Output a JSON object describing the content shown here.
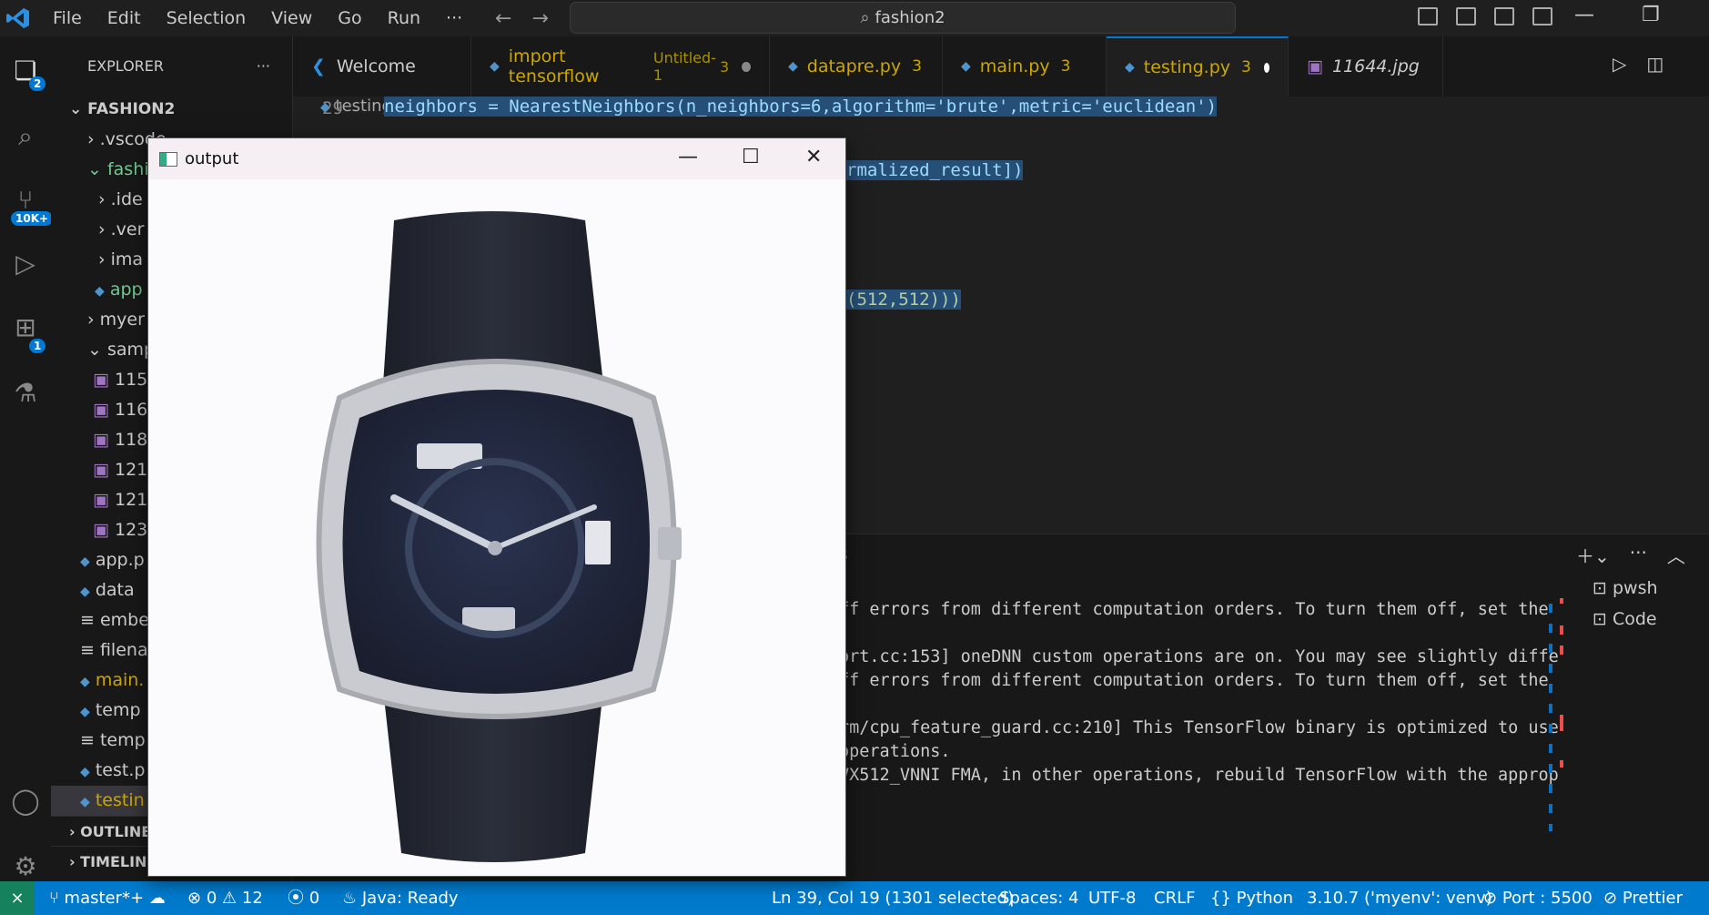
{
  "titlebar": {
    "menu": [
      "File",
      "Edit",
      "Selection",
      "View",
      "Go",
      "Run",
      "···"
    ],
    "search": "fashion2"
  },
  "activity": {
    "explorer_badge": "2",
    "scm_badge": "10K+",
    "ext_badge": "1"
  },
  "sidebar": {
    "title": "EXPLORER",
    "more": "···",
    "root": "FASHION2",
    "items": [
      ".vscode",
      "fashio",
      ".ide",
      ".ver",
      "ima",
      "app",
      "myer",
      "samp",
      "115",
      "116",
      "118",
      "121",
      "121",
      "123",
      "app.p",
      "data",
      "embe",
      "filena",
      "main.",
      "temp",
      "temp",
      "test.p",
      "testin"
    ],
    "outline": "OUTLINE",
    "timeline": "TIMELINE"
  },
  "tabs": [
    {
      "label": "Welcome"
    },
    {
      "label": "import tensorflow",
      "suffix": "Untitled-1",
      "count": "3"
    },
    {
      "label": "datapre.py",
      "count": "3"
    },
    {
      "label": "main.py",
      "count": "3"
    },
    {
      "label": "testing.py",
      "count": "3"
    },
    {
      "label": "11644.jpg"
    }
  ],
  "editor": {
    "breadcrumb_file": "testing.py",
    "breadcrumb_rest": " > ...",
    "line_number": "29",
    "line29": "neighbors = NearestNeighbors(n_neighbors=6,algorithm='brute',metric='euclidean')",
    "line_frag1": "rmalized_result])",
    "line_frag2": "(512,512)))"
  },
  "panel": {
    "header_frag": "s",
    "terminal": [
      "ff errors from different computation orders. To turn them off, set the",
      "ort.cc:153] oneDNN custom operations are on. You may see slightly diffe",
      "ff errors from different computation orders. To turn them off, set the",
      "rm/cpu_feature_guard.cc:210] This TensorFlow binary is optimized to use",
      "operations.",
      "VX512_VNNI FMA, in other operations, rebuild TensorFlow with the approp"
    ],
    "terminals": [
      "pwsh",
      "Code"
    ]
  },
  "output_window": {
    "title": "output"
  },
  "status": {
    "branch": "master*+",
    "errors": "0",
    "warnings": "12",
    "ports": "0",
    "java": "Java: Ready",
    "position": "Ln 39, Col 19 (1301 selected)",
    "spaces": "Spaces: 4",
    "encoding": "UTF-8",
    "eol": "CRLF",
    "language": "Python",
    "interpreter": "3.10.7 ('myenv': venv)",
    "port": "Port : 5500",
    "prettier": "Prettier"
  }
}
